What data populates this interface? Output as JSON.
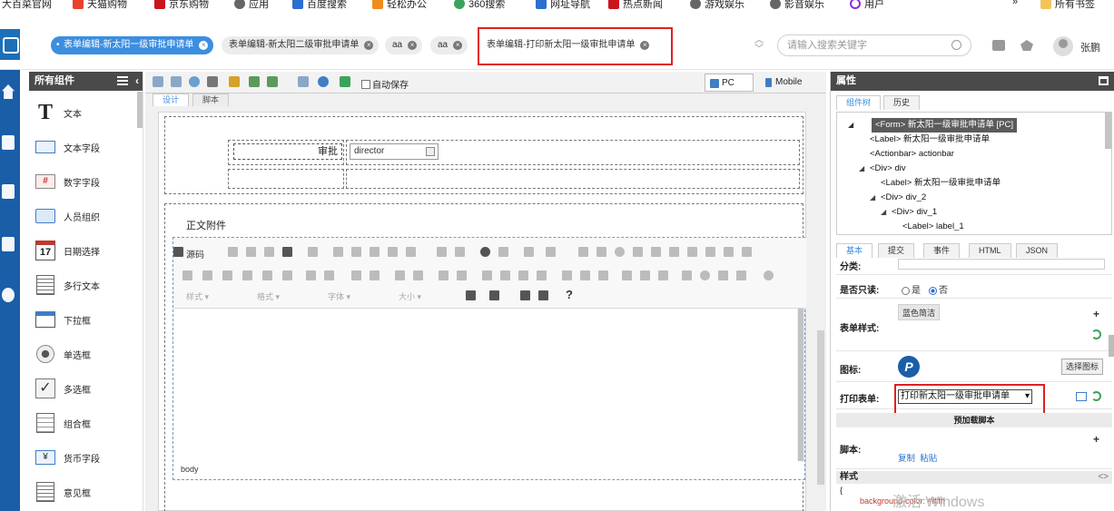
{
  "bookmarks": [
    {
      "label": "大百菜官网",
      "color": "#e9412b"
    },
    {
      "label": "天猫购物",
      "color": "#e9412b"
    },
    {
      "label": "京东购物",
      "color": "#c9151e"
    },
    {
      "label": "应用",
      "color": "#666666"
    },
    {
      "label": "百度搜索",
      "color": "#2d6fd0"
    },
    {
      "label": "轻松办公",
      "color": "#f08b1c"
    },
    {
      "label": "360搜索",
      "color": "#3aa35a"
    },
    {
      "label": "网址导航",
      "color": "#2d6fd0"
    },
    {
      "label": "热点新闻",
      "color": "#c9151e"
    },
    {
      "label": "游戏娱乐",
      "color": "#666666"
    },
    {
      "label": "影音娱乐",
      "color": "#666666"
    },
    {
      "label": "用户",
      "color": "#8a2be2"
    }
  ],
  "bookmarks_more": "»",
  "all_bookmarks": "所有书签",
  "tabs": [
    {
      "label": "表单编辑-新太阳一级审批申请单",
      "active": true
    },
    {
      "label": "表单编辑-新太阳二级审批申请单",
      "active": false
    },
    {
      "label": "aa",
      "active": false
    },
    {
      "label": "aa",
      "active": false
    },
    {
      "label": "表单编辑-打印新太阳一级审批申请单",
      "active": false
    }
  ],
  "search_placeholder": "请输入搜索关键字",
  "user_name": "张鹏",
  "components_title": "所有组件",
  "components": [
    {
      "label": "文本",
      "icon": "text-T-icon"
    },
    {
      "label": "文本字段",
      "icon": "text-field-icon"
    },
    {
      "label": "数字字段",
      "icon": "number-field-icon"
    },
    {
      "label": "人员组织",
      "icon": "person-org-icon"
    },
    {
      "label": "日期选择",
      "icon": "calendar-icon",
      "day": "17"
    },
    {
      "label": "多行文本",
      "icon": "multiline-text-icon"
    },
    {
      "label": "下拉框",
      "icon": "dropdown-icon"
    },
    {
      "label": "单选框",
      "icon": "radio-icon"
    },
    {
      "label": "多选框",
      "icon": "checkbox-icon"
    },
    {
      "label": "组合框",
      "icon": "combo-box-icon"
    },
    {
      "label": "货币字段",
      "icon": "currency-field-icon"
    },
    {
      "label": "意见框",
      "icon": "opinion-box-icon"
    }
  ],
  "toolbar": {
    "autosave_label": "自动保存",
    "view_pc": "PC",
    "view_mobile": "Mobile"
  },
  "editor_tabs": [
    "设计",
    "脚本"
  ],
  "form": {
    "approve_label": "审批",
    "approve_value": "director",
    "attachment_title": "正文附件"
  },
  "rte": {
    "source_label": "源码",
    "combos": [
      "样式",
      "格式",
      "字体",
      "大小"
    ],
    "body_label": "body"
  },
  "props_title": "属性",
  "tree_tabs": [
    "组件树",
    "历史"
  ],
  "tree": [
    {
      "label": "<Form> 新太阳一级审批申请单 [PC]",
      "level": 0,
      "selected": true,
      "expanded": true
    },
    {
      "label": "<Label> 新太阳一级审批申请单",
      "level": 1
    },
    {
      "label": "<Actionbar> actionbar",
      "level": 1
    },
    {
      "label": "<Div> div",
      "level": 1,
      "expanded": true
    },
    {
      "label": "<Label> 新太阳一级审批申请单",
      "level": 2
    },
    {
      "label": "<Div> div_2",
      "level": 2,
      "expanded": true
    },
    {
      "label": "<Div> div_1",
      "level": 3,
      "expanded": true
    },
    {
      "label": "<Label> label_1",
      "level": 4
    }
  ],
  "prop_tabs": [
    "基本",
    "提交",
    "事件",
    "HTML",
    "JSON"
  ],
  "props": {
    "category_label": "分类:",
    "readonly_label": "是否只读:",
    "readonly_yes": "是",
    "readonly_no": "否",
    "readonly_value": "否",
    "form_style_label": "表单样式:",
    "form_style_value": "蓝色简洁",
    "icon_label": "图标:",
    "icon_letter": "P",
    "select_icon_button": "选择图标",
    "print_form_label": "打印表单:",
    "print_form_value": "打印新太阳一级审批申请单",
    "preload_script": "预加载脚本",
    "script_label": "脚本:",
    "copy": "复制",
    "paste": "粘贴",
    "style_label": "样式",
    "style_code_icon": "<>",
    "style_open": "{",
    "style_line": "background-color: #ffffff",
    "watermark": "激活 Windows"
  },
  "colors": {
    "accent": "#3c8ee0",
    "nav_blue": "#1a5ea8",
    "panel_header": "#4a4a4a",
    "highlight_red": "#e02020"
  }
}
